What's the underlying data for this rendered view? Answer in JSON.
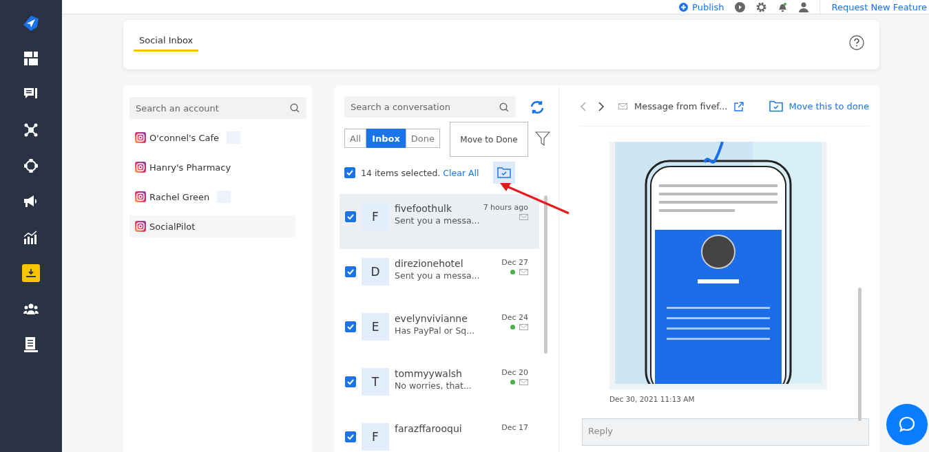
{
  "sidebar": {
    "items": [
      {
        "kind": "dashboard",
        "selected": false
      },
      {
        "kind": "chat",
        "selected": false
      },
      {
        "kind": "network",
        "selected": false
      },
      {
        "kind": "target",
        "selected": false
      },
      {
        "kind": "megaphone",
        "selected": false
      },
      {
        "kind": "chart",
        "selected": false
      },
      {
        "kind": "inbox",
        "selected": true
      },
      {
        "kind": "users",
        "selected": false
      },
      {
        "kind": "document",
        "selected": false
      }
    ]
  },
  "top_bar": {
    "publish": "Publish",
    "notification_dot": true,
    "request_link": "Request New Feature"
  },
  "header": {
    "tabs": [
      {
        "label": "Social Inbox",
        "selected": true
      }
    ]
  },
  "accounts": {
    "search": {
      "placeholder": "Search an account"
    },
    "items": [
      {
        "name": "O'connel's Cafe",
        "badge": true,
        "selected": false
      },
      {
        "name": "Hanry's Pharmacy",
        "badge": false,
        "selected": false
      },
      {
        "name": "Rachel Green",
        "badge": true,
        "selected": false
      },
      {
        "name": "SocialPilot",
        "badge": false,
        "selected": true
      }
    ]
  },
  "conversations": {
    "search": {
      "placeholder": "Search a conversation"
    },
    "filters": [
      {
        "label": "All",
        "selected": false
      },
      {
        "label": "Inbox",
        "selected": true
      },
      {
        "label": "Done",
        "selected": false
      }
    ],
    "tooltip": "Move to Done",
    "selection": {
      "checked": true,
      "text": "14 items selected.",
      "clear": "Clear All"
    },
    "items": [
      {
        "initial": "F",
        "name": "fivefoothulk",
        "preview": "Sent you a messa...",
        "time": "7 hours ago",
        "online": false,
        "checked": true,
        "selected": true
      },
      {
        "initial": "D",
        "name": "direzionehotel",
        "preview": "Sent you a messa...",
        "time": "Dec 27",
        "online": true,
        "checked": true,
        "selected": false
      },
      {
        "initial": "E",
        "name": "evelynvivianne",
        "preview": "Has PayPal or Sq...",
        "time": "Dec 24",
        "online": true,
        "checked": true,
        "selected": false
      },
      {
        "initial": "T",
        "name": "tommyywalsh",
        "preview": "No worries, that...",
        "time": "Dec 20",
        "online": true,
        "checked": true,
        "selected": false
      },
      {
        "initial": "F",
        "name": "farazffarooqui",
        "time": "Dec 17",
        "checked": true,
        "selected": false
      }
    ]
  },
  "message": {
    "title": "Message from fivef...",
    "action": "Move this to done",
    "timestamp": "Dec 30, 2021 11:13 AM",
    "reply": {
      "placeholder": "Reply"
    }
  }
}
